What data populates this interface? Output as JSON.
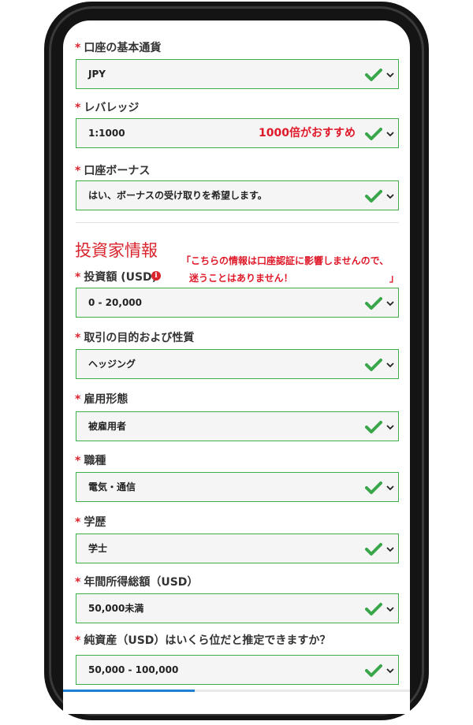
{
  "account": {
    "currency": {
      "required": "*",
      "label": "口座の基本通貨",
      "value": "JPY"
    },
    "leverage": {
      "required": "*",
      "label": "レバレッジ",
      "value": "1:1000",
      "note": "1000倍がおすすめ"
    },
    "bonus": {
      "required": "*",
      "label": "口座ボーナス",
      "value": "はい、ボーナスの受け取りを希望します。"
    }
  },
  "investor": {
    "section_title": "投資家情報",
    "info_glyph": "i",
    "note_line1": "「こちらの情報は口座認証に影響しませんので、",
    "note_line2": "迷うことはありません！",
    "note_close": "」",
    "amount": {
      "required": "*",
      "label": "投資額 (USD)",
      "value": "0 - 20,000"
    },
    "purpose": {
      "required": "*",
      "label": "取引の目的および性質",
      "value": "ヘッジング"
    },
    "employment": {
      "required": "*",
      "label": "雇用形態",
      "value": "被雇用者"
    },
    "occupation": {
      "required": "*",
      "label": "職種",
      "value": "電気・通信"
    },
    "education": {
      "required": "*",
      "label": "学歴",
      "value": "学士"
    },
    "income": {
      "required": "*",
      "label": "年間所得総額（USD）",
      "value": "50,000未満"
    },
    "net_assets": {
      "required": "*",
      "label": "純資産（USD）はいくら位だと推定できますか？",
      "value": "50,000 - 100,000"
    }
  },
  "progress": {
    "fraction": 0.38
  },
  "colors": {
    "valid_border": "#3cae4b",
    "check": "#3aa64a",
    "required": "#d9232d",
    "annotation": "#e0192a",
    "progress": "#1e7fd6"
  },
  "icons": {
    "valid": "check-icon",
    "dropdown": "chevron-down-icon",
    "info": "info-icon"
  }
}
